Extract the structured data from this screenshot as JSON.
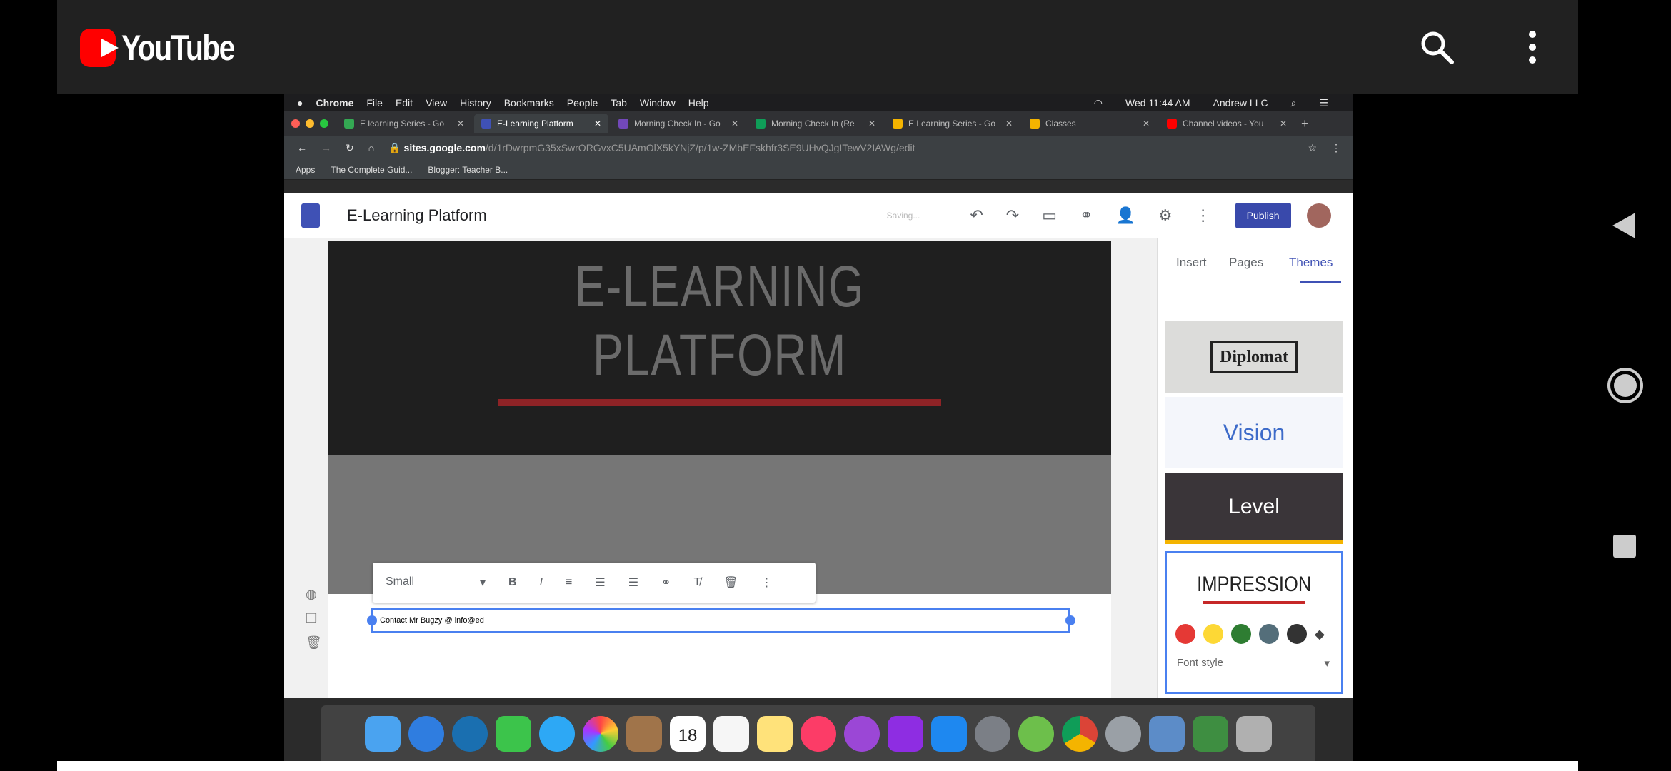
{
  "youtube": {
    "brand": "YouTube",
    "icons": [
      "search-icon",
      "more-vert-icon"
    ]
  },
  "mac_menubar": {
    "items": [
      "Chrome",
      "File",
      "Edit",
      "View",
      "History",
      "Bookmarks",
      "People",
      "Tab",
      "Window",
      "Help"
    ],
    "clock": "Wed 11:44 AM",
    "user": "Andrew LLC"
  },
  "chrome": {
    "tabs": [
      {
        "label": "E learning Series - Go",
        "color": "#34a853"
      },
      {
        "label": "E-Learning Platform",
        "color": "#3f51b5"
      },
      {
        "label": "Morning Check In - Go",
        "color": "#7248b9"
      },
      {
        "label": "Morning Check In (Re",
        "color": "#0f9d58"
      },
      {
        "label": "E Learning Series - Go",
        "color": "#f4b400"
      },
      {
        "label": "Classes",
        "color": "#f4b400"
      },
      {
        "label": "Channel videos - You",
        "color": "#ff0000"
      }
    ],
    "url_host": "sites.google.com",
    "url_path": "/d/1rDwrpmG35xSwrORGvxC5UAmOlX5kYNjZ/p/1w-ZMbEFskhfr3SE9UHvQJgITewV2IAWg/edit",
    "bookmarks": [
      "Apps",
      "The Complete Guid...",
      "Blogger: Teacher B..."
    ]
  },
  "sites": {
    "title": "E-Learning Platform",
    "saving": "Saving...",
    "publish": "Publish",
    "hero_line1": "E-LEARNING",
    "hero_line2": "PLATFORM",
    "hero_accent": "#8e2326",
    "toolbar": {
      "size": "Small",
      "bold": "B",
      "italic": "I"
    },
    "textbox_text": "Contact Mr Bugzy @ info@ed",
    "panel_tabs": [
      "Insert",
      "Pages",
      "Themes"
    ],
    "themes": [
      "Diplomat",
      "Vision",
      "Level",
      "IMPRESSION"
    ],
    "swatches": [
      "#e53935",
      "#fdd835",
      "#2e7d32",
      "#546e7a",
      "#333333"
    ],
    "font_style": "Font style"
  },
  "dock": {
    "calendar_day": "18"
  }
}
